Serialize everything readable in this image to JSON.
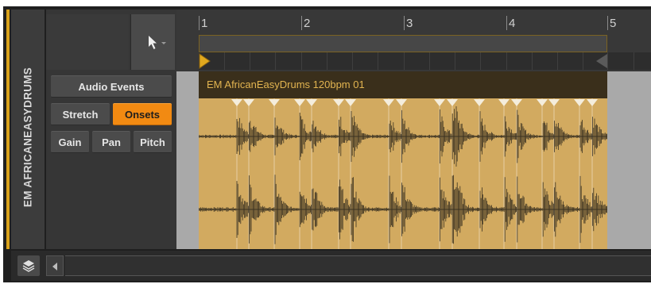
{
  "track": {
    "name": "EM AFRICANEASYDRUMS"
  },
  "inspector": {
    "audio_events_label": "Audio Events",
    "stretch_label": "Stretch",
    "onsets_label": "Onsets",
    "gain_label": "Gain",
    "pan_label": "Pan",
    "pitch_label": "Pitch",
    "active_mode": "Onsets"
  },
  "toolbar": {
    "tool_icon": "pointer-arrow-icon",
    "tool_menu_icon": "chevron-down-icon"
  },
  "ruler": {
    "bars": [
      "1",
      "2",
      "3",
      "4",
      "5"
    ]
  },
  "clip": {
    "name": "EM AfricanEasyDrums 120bpm 01"
  },
  "bottom_bar": {
    "layers_icon": "layers-icon",
    "scroll_left_icon": "arrow-left-icon"
  },
  "colors": {
    "accent": "#d9a21b",
    "onsets_active": "#f28a12",
    "clip_body": "#d2aa60",
    "clip_header": "#3a2f1b",
    "clip_title": "#e2b450",
    "waveform": "#3b3222",
    "onset_marker": "#f4eddc"
  }
}
